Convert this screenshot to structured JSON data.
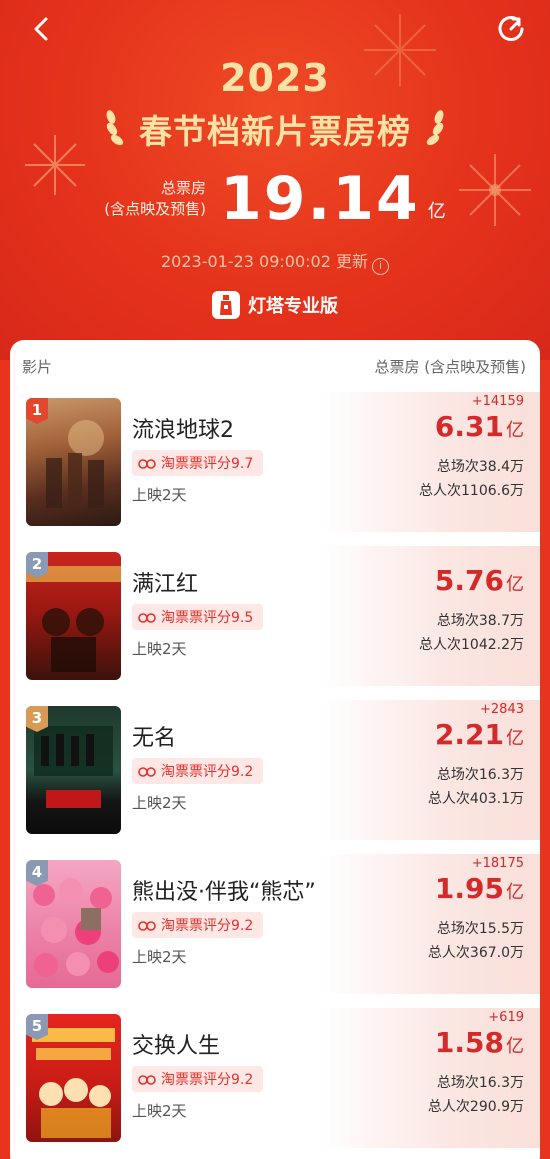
{
  "header": {
    "year": "2023",
    "title": "春节档新片票房榜",
    "total_label_line1": "总票房",
    "total_label_line2": "(含点映及预售)",
    "total_value": "19.14",
    "total_unit": "亿",
    "update_time": "2023-01-23 09:00:02 更新",
    "info_icon": "i",
    "brand": "灯塔专业版"
  },
  "colors": {
    "hero_red": "#e4321b",
    "gold": "#fde2a6",
    "accent_red": "#d42a2a",
    "rank_1": "#e2462e",
    "rank_2": "#8a9ab4",
    "rank_3": "#d89a55",
    "rank_4": "#8a9ab4",
    "rank_5": "#8a9ab4"
  },
  "list": {
    "col_film": "影片",
    "col_box": "总票房 (含点映及预售)",
    "movies": [
      {
        "rank": "1",
        "name": "流浪地球2",
        "score": "淘票票评分9.7",
        "days": "上映2天",
        "increment": "+14159",
        "box": "6.31",
        "unit": "亿",
        "shows": "总场次38.4万",
        "people": "总人次1106.6万"
      },
      {
        "rank": "2",
        "name": "满江红",
        "score": "淘票票评分9.5",
        "days": "上映2天",
        "increment": "",
        "box": "5.76",
        "unit": "亿",
        "shows": "总场次38.7万",
        "people": "总人次1042.2万"
      },
      {
        "rank": "3",
        "name": "无名",
        "score": "淘票票评分9.2",
        "days": "上映2天",
        "increment": "+2843",
        "box": "2.21",
        "unit": "亿",
        "shows": "总场次16.3万",
        "people": "总人次403.1万"
      },
      {
        "rank": "4",
        "name": "熊出没·伴我“熊芯”",
        "score": "淘票票评分9.2",
        "days": "上映2天",
        "increment": "+18175",
        "box": "1.95",
        "unit": "亿",
        "shows": "总场次15.5万",
        "people": "总人次367.0万"
      },
      {
        "rank": "5",
        "name": "交换人生",
        "score": "淘票票评分9.2",
        "days": "上映2天",
        "increment": "+619",
        "box": "1.58",
        "unit": "亿",
        "shows": "总场次16.3万",
        "people": "总人次290.9万"
      }
    ]
  }
}
